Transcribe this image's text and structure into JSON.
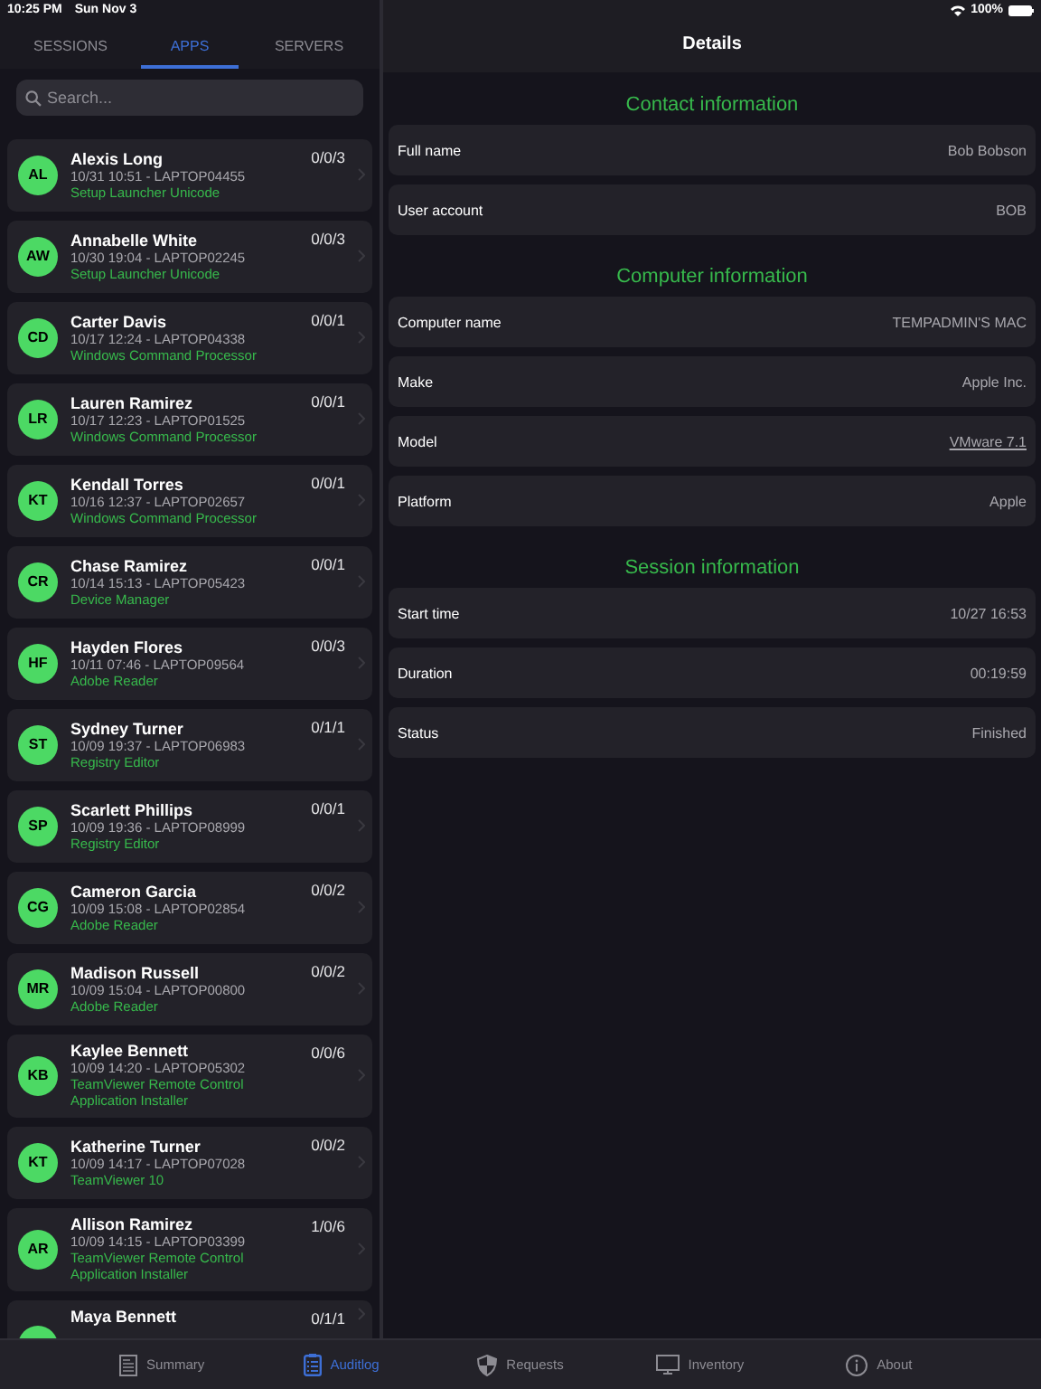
{
  "status_bar": {
    "time": "10:25 PM",
    "date": "Sun Nov 3",
    "battery": "100%"
  },
  "segments": [
    {
      "label": "SESSIONS",
      "selected": false
    },
    {
      "label": "APPS",
      "selected": true
    },
    {
      "label": "SERVERS",
      "selected": false
    }
  ],
  "search": {
    "placeholder": "Search..."
  },
  "sessions": [
    {
      "initials": "AL",
      "name": "Alexis Long",
      "meta": "10/31 10:51 - LAPTOP04455",
      "app": "Setup Launcher Unicode",
      "counts": "0/0/3"
    },
    {
      "initials": "AW",
      "name": "Annabelle White",
      "meta": "10/30 19:04 - LAPTOP02245",
      "app": "Setup Launcher Unicode",
      "counts": "0/0/3"
    },
    {
      "initials": "CD",
      "name": "Carter Davis",
      "meta": "10/17 12:24 - LAPTOP04338",
      "app": "Windows Command Processor",
      "counts": "0/0/1"
    },
    {
      "initials": "LR",
      "name": "Lauren Ramirez",
      "meta": "10/17 12:23 - LAPTOP01525",
      "app": "Windows Command Processor",
      "counts": "0/0/1"
    },
    {
      "initials": "KT",
      "name": "Kendall Torres",
      "meta": "10/16 12:37 - LAPTOP02657",
      "app": "Windows Command Processor",
      "counts": "0/0/1"
    },
    {
      "initials": "CR",
      "name": "Chase Ramirez",
      "meta": "10/14 15:13 - LAPTOP05423",
      "app": "Device Manager",
      "counts": "0/0/1"
    },
    {
      "initials": "HF",
      "name": "Hayden Flores",
      "meta": "10/11 07:46 - LAPTOP09564",
      "app": "Adobe Reader",
      "counts": "0/0/3"
    },
    {
      "initials": "ST",
      "name": "Sydney Turner",
      "meta": "10/09 19:37 - LAPTOP06983",
      "app": "Registry Editor",
      "counts": "0/1/1"
    },
    {
      "initials": "SP",
      "name": "Scarlett Phillips",
      "meta": "10/09 19:36 - LAPTOP08999",
      "app": "Registry Editor",
      "counts": "0/0/1"
    },
    {
      "initials": "CG",
      "name": "Cameron Garcia",
      "meta": "10/09 15:08 - LAPTOP02854",
      "app": "Adobe Reader",
      "counts": "0/0/2"
    },
    {
      "initials": "MR",
      "name": "Madison Russell",
      "meta": "10/09 15:04 - LAPTOP00800",
      "app": "Adobe Reader",
      "counts": "0/0/2"
    },
    {
      "initials": "KB",
      "name": "Kaylee Bennett",
      "meta": "10/09 14:20 - LAPTOP05302",
      "app": "TeamViewer Remote Control Application Installer",
      "counts": "0/0/6"
    },
    {
      "initials": "KT",
      "name": "Katherine Turner",
      "meta": "10/09 14:17 - LAPTOP07028",
      "app": "TeamViewer 10",
      "counts": "0/0/2"
    },
    {
      "initials": "AR",
      "name": "Allison Ramirez",
      "meta": "10/09 14:15 - LAPTOP03399",
      "app": "TeamViewer Remote Control Application Installer",
      "counts": "1/0/6"
    },
    {
      "name": "Maya Bennett",
      "counts": "0/1/1"
    }
  ],
  "details": {
    "title": "Details",
    "sections": [
      {
        "title": "Contact information",
        "rows": [
          {
            "label": "Full name",
            "value": "Bob Bobson",
            "kind": "text"
          },
          {
            "label": "User account",
            "value": "BOB",
            "kind": "text"
          }
        ]
      },
      {
        "title": "Computer information",
        "rows": [
          {
            "label": "Computer name",
            "value": "TEMPADMIN'S MAC",
            "kind": "text"
          },
          {
            "label": "Make",
            "value": "Apple Inc.",
            "kind": "text"
          },
          {
            "label": "Model",
            "value": "VMware 7.1",
            "kind": "link"
          },
          {
            "label": "Platform",
            "value": "Apple",
            "kind": "text"
          }
        ]
      },
      {
        "title": "Session information",
        "rows": [
          {
            "label": "Start time",
            "value": "10/27 16:53",
            "kind": "text"
          },
          {
            "label": "Duration",
            "value": "00:19:59",
            "kind": "text"
          },
          {
            "label": "Status",
            "value": "Finished",
            "kind": "text"
          }
        ]
      }
    ]
  },
  "tab_bar": [
    {
      "label": "Summary",
      "selected": false
    },
    {
      "label": "Auditlog",
      "selected": true
    },
    {
      "label": "Requests",
      "selected": false
    },
    {
      "label": "Inventory",
      "selected": false
    },
    {
      "label": "About",
      "selected": false
    }
  ]
}
